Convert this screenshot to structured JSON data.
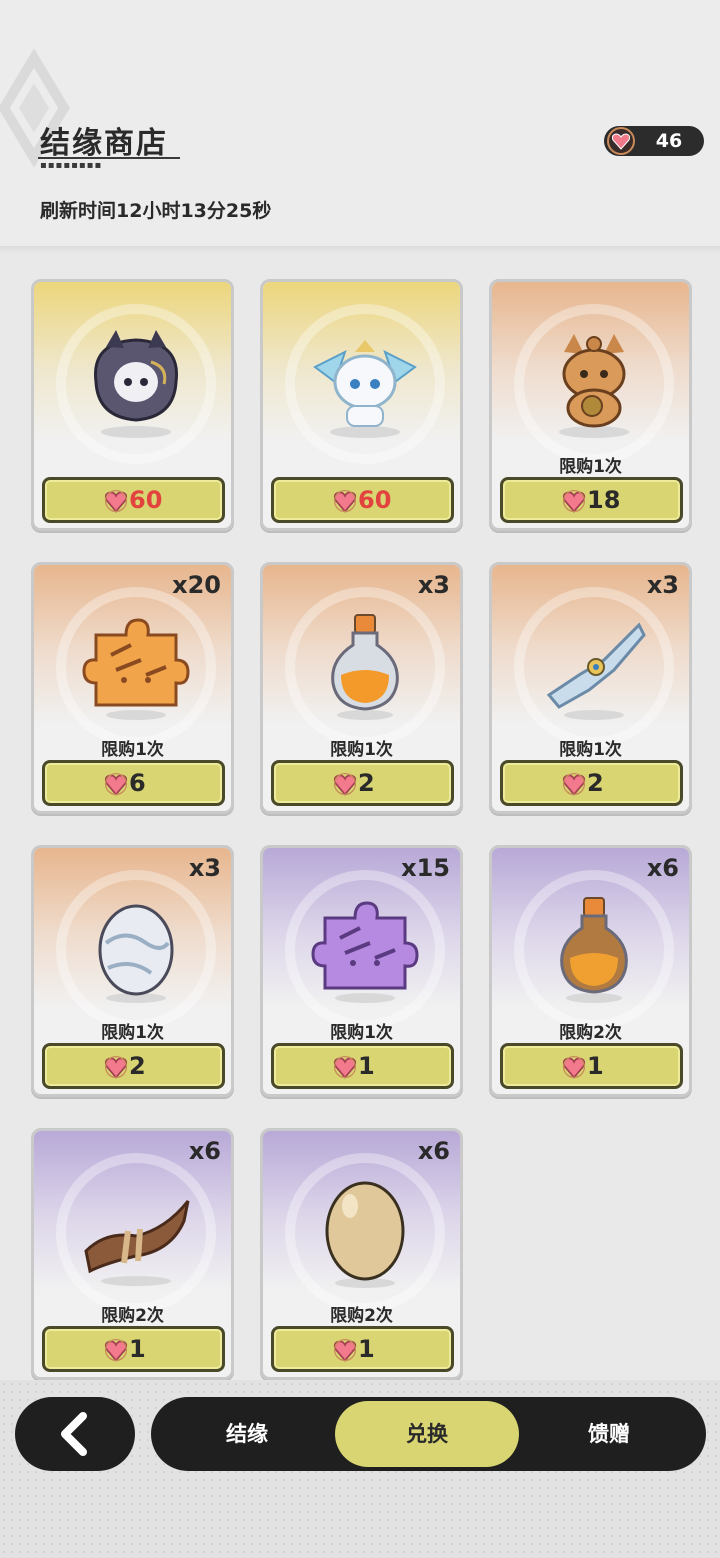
{
  "header": {
    "title": "结缘商店",
    "refresh_text": "刷新时间12小时13分25秒",
    "currency": {
      "icon": "heart-gem-icon",
      "amount": "46"
    }
  },
  "items": [
    {
      "name": "dark-cat-spirit",
      "icon": "dark-cat-spirit-icon",
      "bg": "gold",
      "quantity": "",
      "limit": "",
      "price": "60",
      "price_color": "#e2433f"
    },
    {
      "name": "crystal-fox-spirit",
      "icon": "crystal-fox-spirit-icon",
      "bg": "gold",
      "quantity": "",
      "limit": "",
      "price": "60",
      "price_color": "#e2433f"
    },
    {
      "name": "brown-fox-spirit",
      "icon": "brown-fox-spirit-icon",
      "bg": "orange",
      "quantity": "",
      "limit": "限购1次",
      "price": "18",
      "price_color": "#2a2a2a"
    },
    {
      "name": "orange-puzzle-piece",
      "icon": "orange-puzzle-piece-icon",
      "bg": "orange",
      "quantity": "x20",
      "limit": "限购1次",
      "price": "6",
      "price_color": "#2a2a2a"
    },
    {
      "name": "orange-potion",
      "icon": "orange-potion-icon",
      "bg": "orange",
      "quantity": "x3",
      "limit": "限购1次",
      "price": "2",
      "price_color": "#2a2a2a"
    },
    {
      "name": "blue-scroll",
      "icon": "blue-scroll-icon",
      "bg": "orange",
      "quantity": "x3",
      "limit": "限购1次",
      "price": "2",
      "price_color": "#2a2a2a"
    },
    {
      "name": "silver-egg",
      "icon": "silver-egg-icon",
      "bg": "orange",
      "quantity": "x3",
      "limit": "限购1次",
      "price": "2",
      "price_color": "#2a2a2a"
    },
    {
      "name": "purple-puzzle-piece",
      "icon": "purple-puzzle-piece-icon",
      "bg": "purple",
      "quantity": "x15",
      "limit": "限购1次",
      "price": "1",
      "price_color": "#2a2a2a"
    },
    {
      "name": "amber-potion",
      "icon": "amber-potion-icon",
      "bg": "purple",
      "quantity": "x6",
      "limit": "限购2次",
      "price": "1",
      "price_color": "#2a2a2a"
    },
    {
      "name": "wood-bundle",
      "icon": "wood-bundle-icon",
      "bg": "purple",
      "quantity": "x6",
      "limit": "限购2次",
      "price": "1",
      "price_color": "#2a2a2a"
    },
    {
      "name": "plain-egg",
      "icon": "plain-egg-icon",
      "bg": "purple",
      "quantity": "x6",
      "limit": "限购2次",
      "price": "1",
      "price_color": "#2a2a2a"
    }
  ],
  "nav": {
    "back_icon": "chevron-left-icon",
    "tabs": [
      {
        "label": "结缘",
        "active": false
      },
      {
        "label": "兑换",
        "active": true
      },
      {
        "label": "馈赠",
        "active": false
      }
    ]
  }
}
